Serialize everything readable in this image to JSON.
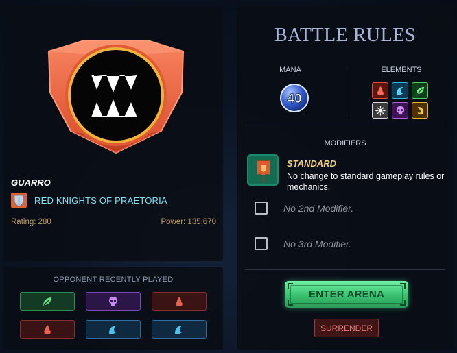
{
  "player": {
    "name": "GUARRO",
    "guild_name": "RED KNIGHTS OF PRAETORIA",
    "rating_text": "Rating: 280",
    "power_text": "Power: 135,670",
    "emblem_icon": "fanged-mouth-emblem-icon",
    "guild_icon": "guild-shield-icon"
  },
  "opponent": {
    "title": "OPPONENT RECENTLY PLAYED",
    "recent_splinters": [
      "earth",
      "death",
      "fire",
      "fire",
      "water",
      "water"
    ]
  },
  "rules": {
    "title": "BATTLE RULES",
    "mana_label": "MANA",
    "mana_value": "40",
    "elements_label": "ELEMENTS",
    "elements": [
      "fire",
      "water",
      "earth",
      "life",
      "death",
      "dragon"
    ],
    "modifiers_label": "MODIFIERS",
    "modifier": {
      "name": "STANDARD",
      "description": "No change to standard gameplay rules or mechanics.",
      "icon": "standard-banner-icon"
    },
    "slots": [
      "No 2nd Modifier.",
      "No 3rd Modifier."
    ]
  },
  "actions": {
    "enter_label": "ENTER ARENA",
    "surrender_label": "SURRENDER"
  },
  "colors": {
    "fire": "#e84a3c",
    "water": "#2fb8e0",
    "earth": "#4bd060",
    "life": "#e6e6e6",
    "death": "#b35be0",
    "dragon": "#f0b12a",
    "accent_cyan": "#7fe0f2",
    "gold": "#c49b5e"
  }
}
